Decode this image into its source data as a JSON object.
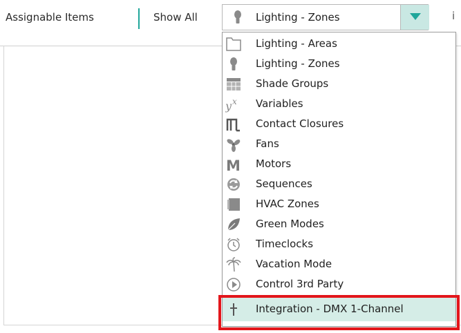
{
  "toolbar": {
    "assignable_label": "Assignable Items",
    "show_all_label": "Show All",
    "selected_value": "Lighting - Zones",
    "selected_icon": "bulb-icon",
    "trailing_text": "i"
  },
  "dropdown": {
    "items": [
      {
        "label": "Lighting - Areas",
        "icon": "area-icon"
      },
      {
        "label": "Lighting - Zones",
        "icon": "bulb-icon"
      },
      {
        "label": "Shade Groups",
        "icon": "shade-icon"
      },
      {
        "label": "Variables",
        "icon": "variable-icon"
      },
      {
        "label": "Contact Closures",
        "icon": "contact-closure-icon"
      },
      {
        "label": "Fans",
        "icon": "fan-icon"
      },
      {
        "label": "Motors",
        "icon": "motor-icon"
      },
      {
        "label": "Sequences",
        "icon": "sequence-icon"
      },
      {
        "label": "HVAC Zones",
        "icon": "hvac-icon"
      },
      {
        "label": "Green Modes",
        "icon": "leaf-icon"
      },
      {
        "label": "Timeclocks",
        "icon": "alarm-clock-icon"
      },
      {
        "label": "Vacation Mode",
        "icon": "palm-tree-icon"
      },
      {
        "label": "Control 3rd Party",
        "icon": "play-circle-icon"
      },
      {
        "label": "Integration - DMX 1-Channel",
        "icon": "dmx-icon"
      }
    ],
    "selected_item": "Integration - DMX 1-Channel"
  },
  "colors": {
    "accent": "#1fa69a",
    "selection": "#d5ede7",
    "highlight": "#e3161b",
    "icon_gray": "#8a8a8a"
  }
}
